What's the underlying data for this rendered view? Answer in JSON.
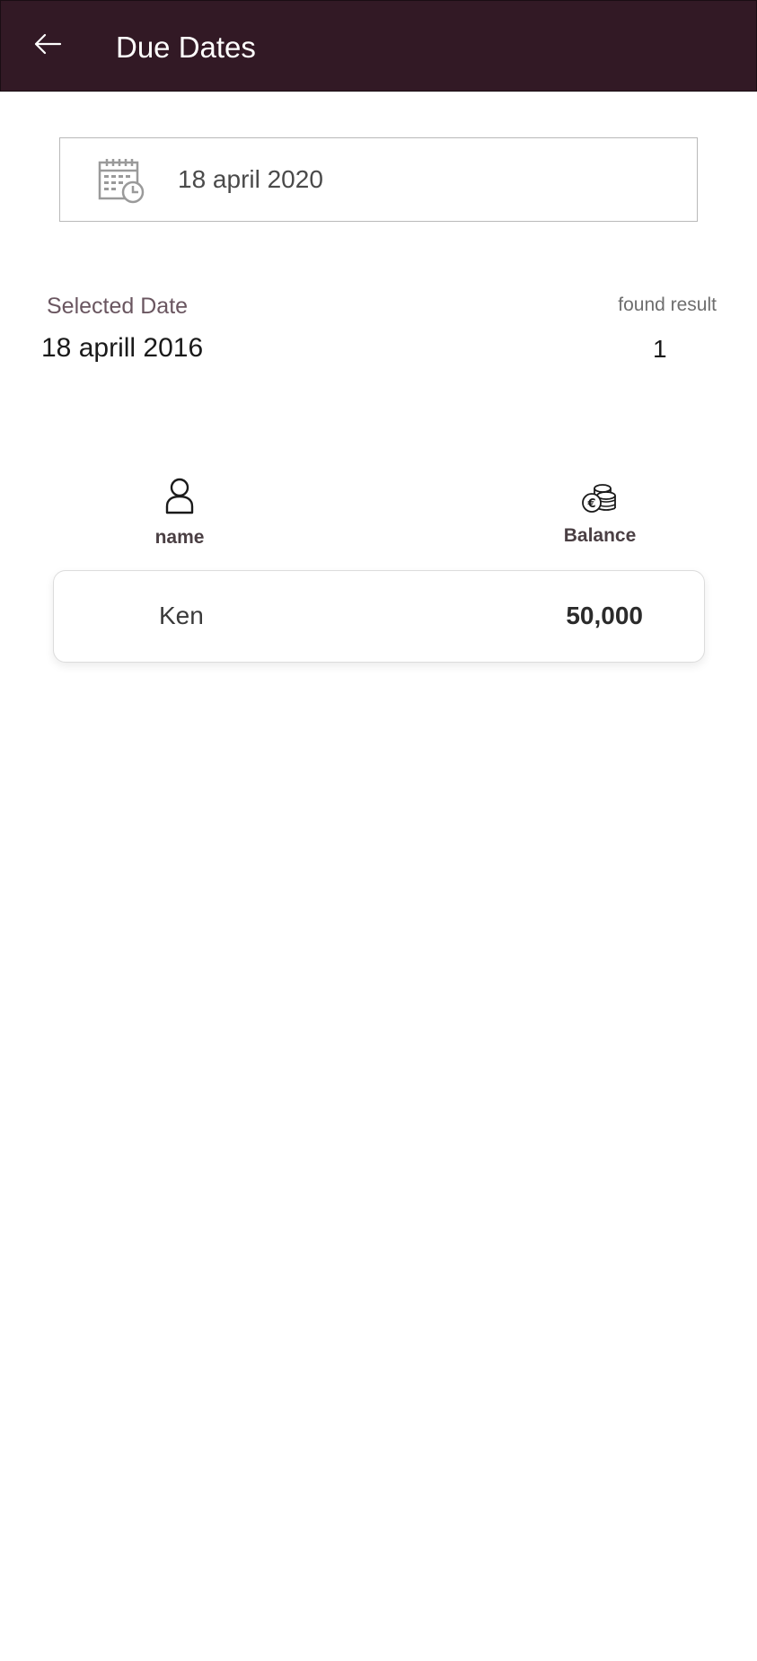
{
  "header": {
    "title": "Due Dates",
    "back_icon": "arrow-left-icon",
    "background_color": "#321925"
  },
  "date_picker": {
    "value": "18 april 2020",
    "icon": "calendar-clock-icon"
  },
  "summary": {
    "selected_label": "Selected Date",
    "selected_value": "18 aprill 2016",
    "found_label": "found result",
    "found_value": "1"
  },
  "columns": {
    "name_label": "name",
    "name_icon": "user-icon",
    "balance_label": "Balance",
    "balance_icon": "coins-euro-icon"
  },
  "results": [
    {
      "name": "Ken",
      "balance": "50,000"
    }
  ]
}
